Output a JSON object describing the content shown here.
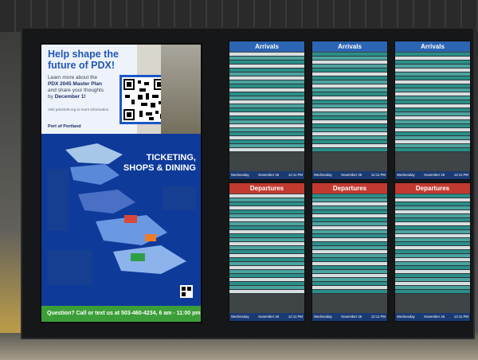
{
  "poster": {
    "headline": "Help shape the future of PDX!",
    "body_intro": "Learn more about the",
    "body_plan": "PDX 2045 Master Plan",
    "body_share": "and share your thoughts",
    "body_by": "by",
    "body_deadline": "December 1!",
    "body_link": "Visit pdx2045.org to more information.",
    "brand": "Port of Portland",
    "map_title": "TICKETING, SHOPS & DINING",
    "bottom_question": "Question?",
    "bottom_call": "Call or text us at",
    "bottom_phone": "503-460-4234",
    "bottom_hours": ", 6 am - 11:00 pm"
  },
  "arrivals_boards": [
    {
      "title": "Arrivals",
      "day": "Wednesday",
      "date": "November 26",
      "time": "12:11 PM"
    },
    {
      "title": "Arrivals",
      "day": "Wednesday",
      "date": "November 26",
      "time": "12:11 PM"
    },
    {
      "title": "Arrivals",
      "day": "Wednesday",
      "date": "November 26",
      "time": "12:11 PM"
    }
  ],
  "departures_boards": [
    {
      "title": "Departures",
      "day": "Wednesday",
      "date": "November 26",
      "time": "12:11 PM"
    },
    {
      "title": "Departures",
      "day": "Wednesday",
      "date": "November 26",
      "time": "12:11 PM"
    },
    {
      "title": "Departures",
      "day": "Wednesday",
      "date": "November 26",
      "time": "12:11 PM"
    }
  ],
  "colors": {
    "arrivals_header": "#2c65b3",
    "departures_header": "#c23a2f",
    "poster_blue": "#0d2f7a",
    "poster_green_bar": "#3c9e38"
  }
}
